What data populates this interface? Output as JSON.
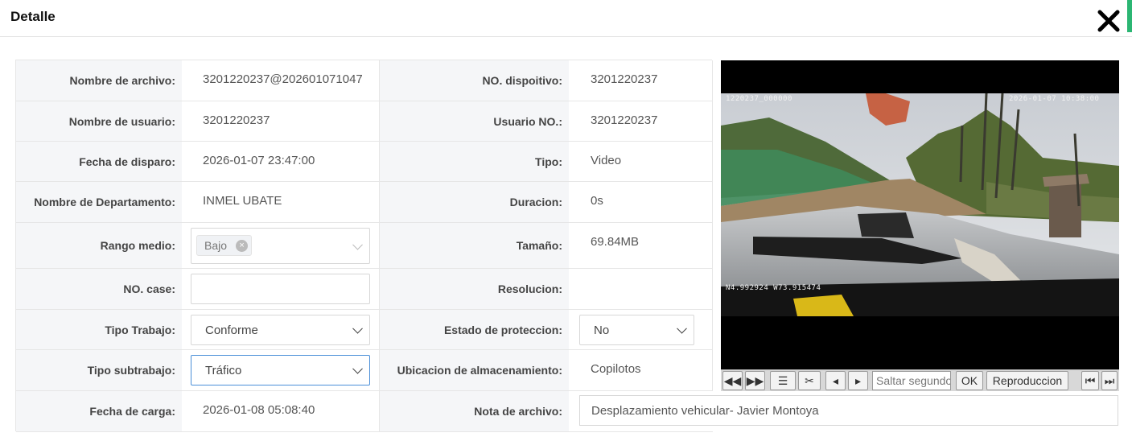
{
  "header": {
    "title": "Detalle"
  },
  "fields": {
    "nombre_archivo": {
      "label": "Nombre de archivo:",
      "value": "3201220237@202601071047"
    },
    "no_dispositivo": {
      "label": "NO. dispoitivo:",
      "value": "3201220237"
    },
    "nombre_usuario": {
      "label": "Nombre de usuario:",
      "value": "3201220237"
    },
    "usuario_no": {
      "label": "Usuario NO.:",
      "value": "3201220237"
    },
    "fecha_disparo": {
      "label": "Fecha de disparo:",
      "value": "2026-01-07 23:47:00"
    },
    "tipo": {
      "label": "Tipo:",
      "value": "Video"
    },
    "departamento": {
      "label": "Nombre de Departamento:",
      "value": "INMEL UBATE"
    },
    "duracion": {
      "label": "Duracion:",
      "value": "0s"
    },
    "rango_medio": {
      "label": "Rango medio:",
      "tag": "Bajo"
    },
    "tamano": {
      "label": "Tamaño:",
      "value": "69.84MB"
    },
    "no_case": {
      "label": "NO. case:",
      "value": ""
    },
    "resolucion": {
      "label": "Resolucion:",
      "value": ""
    },
    "tipo_trabajo": {
      "label": "Tipo Trabajo:",
      "selected": "Conforme"
    },
    "estado_proteccion": {
      "label": "Estado de proteccion:",
      "selected": "No"
    },
    "tipo_subtrabajo": {
      "label": "Tipo subtrabajo:",
      "selected": "Tráfico"
    },
    "ubicacion": {
      "label": "Ubicacion de almacenamiento:",
      "value": "Copilotos"
    },
    "fecha_carga": {
      "label": "Fecha de carga:",
      "value": "2026-01-08 05:08:40"
    },
    "nota_archivo": {
      "label": "Nota de archivo:",
      "value": "Desplazamiento vehicular- Javier Montoya"
    }
  },
  "video": {
    "osd_file": "1220237_000000",
    "osd_datetime": "2026-01-07  10:38:00",
    "osd_gps": "N4.992924  W73.915474"
  },
  "player": {
    "seek_placeholder": "Saltar segundos",
    "ok_label": "OK",
    "playback_label": "Reproduccion"
  },
  "colors": {
    "accent": "#2bb673",
    "label_bg": "#f5f6f8",
    "border": "#e6e6e6",
    "input_active": "#4a8fd8"
  },
  "icons": [
    "close-icon",
    "rewind-icon",
    "fast-forward-icon",
    "list-icon",
    "scissors-icon",
    "prev-frame-icon",
    "next-frame-icon",
    "skip-start-icon",
    "skip-end-icon",
    "clear-tag-icon",
    "chevron-down-icon"
  ]
}
